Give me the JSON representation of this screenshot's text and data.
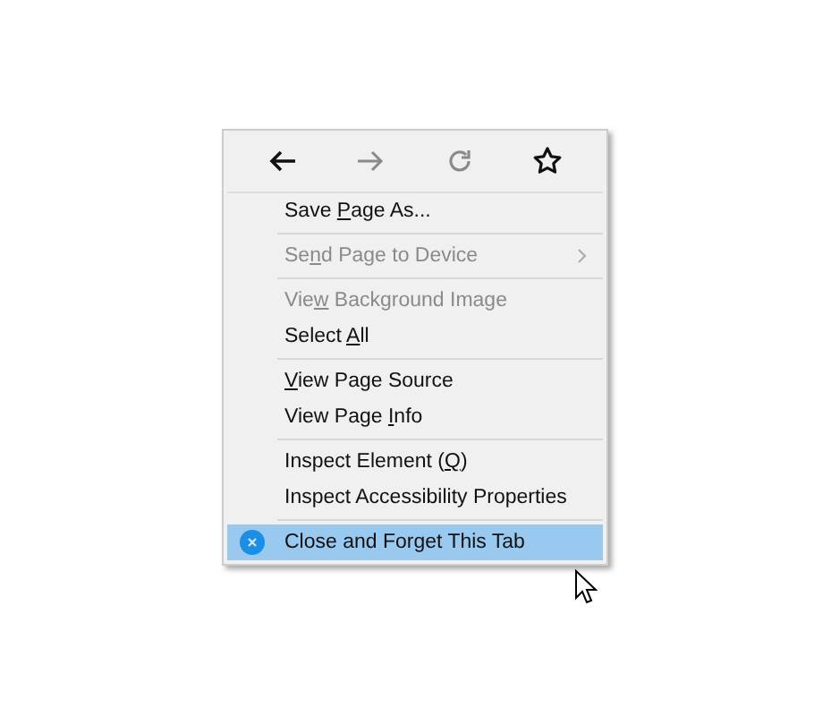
{
  "toolbar": [
    {
      "kind": "back",
      "disabled": false
    },
    {
      "kind": "forward",
      "disabled": true
    },
    {
      "kind": "reload",
      "disabled": true
    },
    {
      "kind": "bookmark",
      "disabled": false
    }
  ],
  "menu": [
    {
      "kind": "item",
      "before": "Save ",
      "key": "P",
      "after": "age As...",
      "disabled": false,
      "selected": false
    },
    {
      "kind": "separator"
    },
    {
      "kind": "submenu",
      "before": "Se",
      "key": "n",
      "after": "d Page to Device",
      "disabled": true,
      "selected": false
    },
    {
      "kind": "separator"
    },
    {
      "kind": "item",
      "before": "Vie",
      "key": "w",
      "after": " Background Image",
      "disabled": true,
      "selected": false
    },
    {
      "kind": "item",
      "before": "Select ",
      "key": "A",
      "after": "ll",
      "disabled": false,
      "selected": false
    },
    {
      "kind": "separator"
    },
    {
      "kind": "item",
      "key": "V",
      "after": "iew Page Source",
      "disabled": false,
      "selected": false
    },
    {
      "kind": "item",
      "before": "View Page ",
      "key": "I",
      "after": "nfo",
      "disabled": false,
      "selected": false
    },
    {
      "kind": "separator"
    },
    {
      "kind": "item",
      "before": "Inspect Element (",
      "key": "Q",
      "after": ")",
      "disabled": false,
      "selected": false
    },
    {
      "kind": "item",
      "before": "Inspect Accessibility Properties",
      "disabled": false,
      "selected": false
    },
    {
      "kind": "separator"
    },
    {
      "kind": "close",
      "before": "Close and Forget This Tab",
      "disabled": false,
      "selected": true
    }
  ]
}
